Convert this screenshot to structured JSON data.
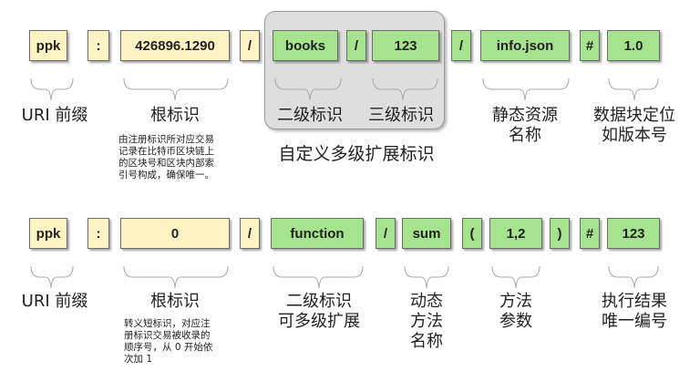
{
  "row1": {
    "segments": [
      "ppk",
      ":",
      "426896.1290",
      "/",
      "books",
      "/",
      "123",
      "/",
      "info.json",
      "#",
      "1.0"
    ],
    "labels": {
      "uri_prefix": "URI 前缀",
      "root_id": "根标识",
      "level2": "二级标识",
      "level3": "三级标识",
      "static_resource": "静态资源\n名称",
      "block_locator": "数据块定位\n如版本号",
      "custom_multilevel": "自定义多级扩展标识"
    },
    "root_note": "由注册标识所对应交易\n记录在比特币区块链上\n的区块号和区块内部索\n引号构成，确保唯一。"
  },
  "row2": {
    "segments": [
      "ppk",
      ":",
      "0",
      "/",
      "function",
      "/",
      "sum",
      "(",
      "1,2",
      ")",
      "#",
      "123"
    ],
    "labels": {
      "uri_prefix": "URI 前缀",
      "root_id": "根标识",
      "level2_ext": "二级标识\n可多级扩展",
      "dynamic_method": "动态\n方法\n名称",
      "method_params": "方法\n参数",
      "exec_result": "执行结果\n唯一编号"
    },
    "root_note": "转义短标识，对应注\n册标识交易被收录的\n顺序号，从 0 开始依\n次加 1"
  },
  "colors": {
    "yellow_box": "#fff3c4",
    "green_box": "#a6e38f",
    "group_bg": "#dedede"
  }
}
